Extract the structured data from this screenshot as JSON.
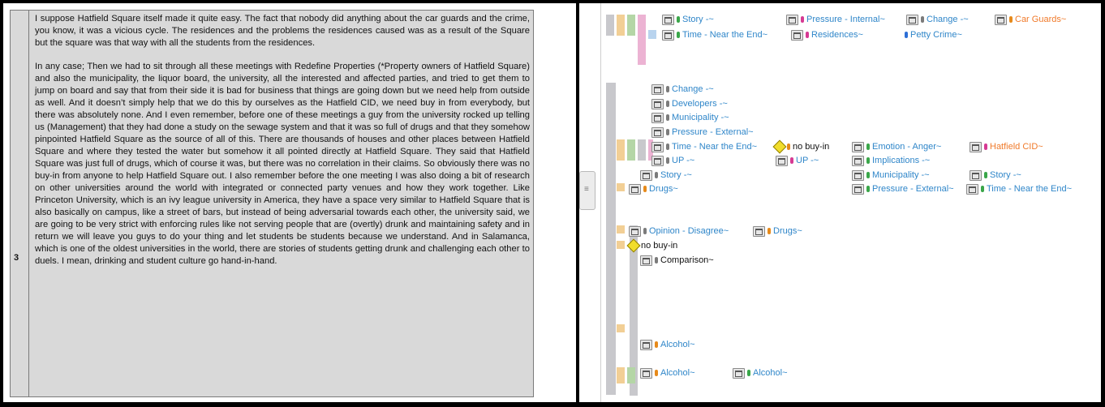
{
  "document": {
    "row_number": "3",
    "paragraph1": "I suppose Hatfield Square itself made it quite easy. The fact that nobody did anything about the car guards and the crime, you know, it was a vicious cycle. The residences and the problems the residences caused was as a result of the Square but the square was that way with all the students from the residences.",
    "paragraph2": "In any case; Then we had to sit through all these meetings with Redefine Properties (*Property owners of Hatfield Square) and also the municipality, the liquor board, the university, all the interested and affected parties, and tried to get them to jump on board and say that from their side it is bad for business that things are going down but we need help from outside as well. And it doesn’t simply help that we do this by ourselves as the Hatfield CID, we need buy in from everybody, but there was absolutely none. And I even remember, before one of these meetings a guy from the university rocked up telling us (Management) that they had done a study on the sewage system and that it was so full of drugs and that they somehow pinpointed Hatfield Square as the source of all of this. There are thousands of houses and other places between Hatfield Square and where they tested the water but somehow it all pointed directly at Hatfield Square. They said that Hatfield Square was just full of drugs, which of course it was, but there was no correlation in their claims. So obviously there was no buy-in from anyone to help Hatfield Square out. I also remember before the one meeting I was also doing a bit of research on other universities around the world with integrated or connected party venues and how they work together. Like Princeton University, which is an ivy league university in America, they have a space very similar to Hatfield Square that is also basically on campus, like a street of bars, but instead of being adversarial towards each other, the university said, we are going to be very strict with enforcing rules like not serving people that are (overtly) drunk and maintaining safety and in return we will leave you guys to do your thing and let students be students because we understand. And in Salamanca, which is one of the oldest universities in the world, there are stories of students getting drunk and challenging each other to duels. I mean, drinking and student culture go hand-in-hand."
  },
  "splitter": {
    "grip_glyph": "≡"
  },
  "colors": {
    "code_blue": "#2f86c9",
    "code_orange": "#f07a2a",
    "dot_green": "#3aa64a",
    "dot_pink": "#d63a93",
    "dot_gray": "#7b7b7b",
    "dot_blue": "#2d6fd6",
    "dot_orange": "#e68a1b"
  },
  "codes": {
    "group1": [
      {
        "label": "Story -~",
        "dot": "green"
      },
      {
        "label": "Pressure - Internal~",
        "dot": "pink"
      },
      {
        "label": "Change -~",
        "dot": "gray"
      },
      {
        "label": "Car Guards~",
        "dot": "orange",
        "color": "orange"
      },
      {
        "label": "Time - Near the End~",
        "dot": "green"
      },
      {
        "label": "Residences~",
        "dot": "pink"
      },
      {
        "label": "Petty Crime~",
        "dot": "blue"
      }
    ],
    "group2": [
      {
        "label": "Change -~",
        "dot": "gray"
      },
      {
        "label": "Developers -~",
        "dot": "gray"
      },
      {
        "label": "Municipality -~",
        "dot": "gray"
      },
      {
        "label": "Pressure - External~",
        "dot": "gray"
      },
      {
        "label": "Time - Near the End~",
        "dot": "gray"
      },
      {
        "label": "no buy-in",
        "dot": "orange",
        "icon": "memo",
        "color": "black"
      },
      {
        "label": "Emotion - Anger~",
        "dot": "green"
      },
      {
        "label": "Hatfield CID~",
        "dot": "pink",
        "color": "orange"
      },
      {
        "label": "UP -~",
        "dot": "gray"
      },
      {
        "label": "UP -~",
        "dot": "pink"
      },
      {
        "label": "Implications -~",
        "dot": "green"
      },
      {
        "label": "Story -~",
        "dot": "gray"
      },
      {
        "label": "Municipality -~",
        "dot": "green"
      },
      {
        "label": "Story -~",
        "dot": "green"
      },
      {
        "label": "Drugs~",
        "dot": "orange"
      },
      {
        "label": "Pressure - External~",
        "dot": "green"
      },
      {
        "label": "Time - Near the End~",
        "dot": "green"
      }
    ],
    "group3": [
      {
        "label": "Opinion - Disagree~",
        "dot": "gray"
      },
      {
        "label": "Drugs~",
        "dot": "orange"
      },
      {
        "label": "no buy-in",
        "icon": "memo",
        "color": "black"
      },
      {
        "label": "Comparison~",
        "dot": "gray",
        "color": "black"
      },
      {
        "label": "Alcohol~",
        "dot": "orange"
      },
      {
        "label": "Alcohol~",
        "dot": "orange"
      },
      {
        "label": "Alcohol~",
        "dot": "green"
      }
    ]
  }
}
